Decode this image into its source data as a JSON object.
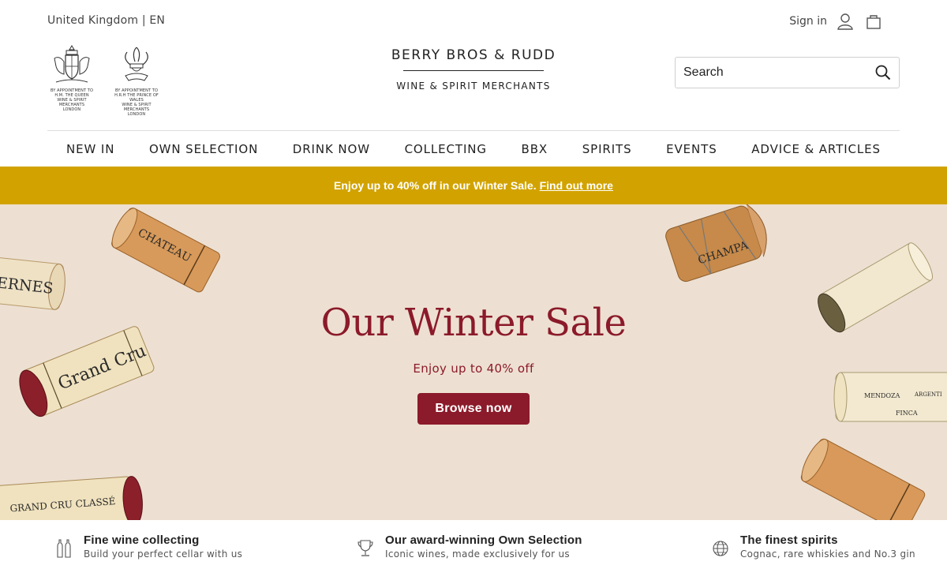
{
  "header": {
    "locale": "United Kingdom | EN",
    "sign_in": "Sign in",
    "warrants": [
      {
        "line1": "BY APPOINTMENT TO",
        "line2": "H.M. THE QUEEN",
        "line3": "WINE & SPIRIT MERCHANTS",
        "line4": "LONDON"
      },
      {
        "line1": "BY APPOINTMENT TO",
        "line2": "H.R.H THE PRINCE OF WALES",
        "line3": "WINE & SPIRIT MERCHANTS",
        "line4": "LONDON"
      }
    ],
    "logo_title": "BERRY BROS & RUDD",
    "logo_subtitle": "WINE & SPIRIT MERCHANTS",
    "search_placeholder": "Search"
  },
  "nav": {
    "items": [
      "NEW IN",
      "OWN SELECTION",
      "DRINK NOW",
      "COLLECTING",
      "BBX",
      "SPIRITS",
      "EVENTS",
      "ADVICE & ARTICLES"
    ]
  },
  "promo": {
    "text": "Enjoy up to 40% off in our Winter Sale.",
    "link": "Find out more",
    "color": "#d2a300"
  },
  "hero": {
    "title": "Our Winter Sale",
    "subtitle": "Enjoy up to 40% off",
    "button": "Browse now",
    "accent": "#8b1a2a",
    "background": "#ede0d2",
    "cork_labels": [
      "ERNES",
      "CHATEAU",
      "Grand Cru",
      "CHAMPA",
      "MENDOZA",
      "ARGENTI",
      "FINCA",
      "GRAND CRU CLASSÉ"
    ]
  },
  "features": [
    {
      "title": "Fine wine collecting",
      "subtitle": "Build your perfect cellar with us",
      "icon": "bottles-icon"
    },
    {
      "title": "Our award-winning Own Selection",
      "subtitle": "Iconic wines, made exclusively for us",
      "icon": "trophy-icon"
    },
    {
      "title": "The finest spirits",
      "subtitle": "Cognac, rare whiskies and No.3 gin",
      "icon": "globe-icon"
    }
  ]
}
